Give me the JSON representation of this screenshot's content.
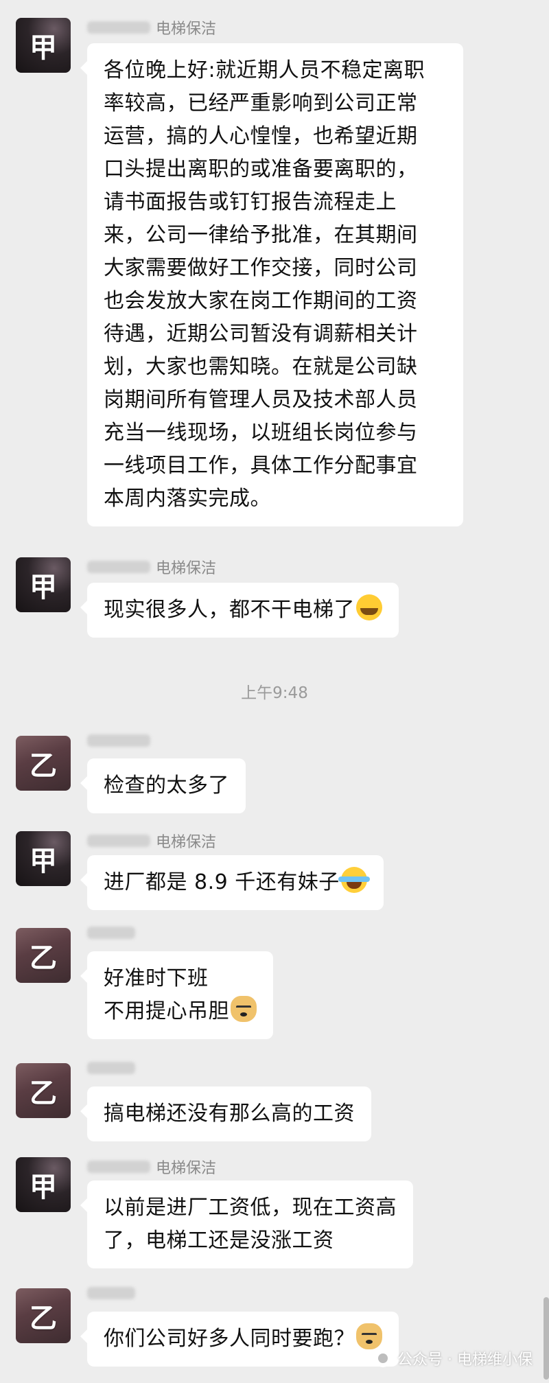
{
  "messages": [
    {
      "avatar": "甲",
      "sender": "电梯保洁",
      "lines": [
        "各位晚上好:就近期人员不稳定离职",
        "率较高，已经严重影响到公司正常",
        "运营，搞的人心惶惶，也希望近期",
        "口头提出离职的或准备要离职的，",
        "请书面报告或钉钉报告流程走上",
        "来，公司一律给予批准，在其期间",
        "大家需要做好工作交接，同时公司",
        "也会发放大家在岗工作期间的工资",
        "待遇，近期公司暂没有调薪相关计",
        "划，大家也需知晓。在就是公司缺",
        "岗期间所有管理人员及技术部人员",
        "充当一线现场，以班组长岗位参与",
        "一线项目工作，具体工作分配事宜",
        "本周内落实完成。"
      ]
    },
    {
      "avatar": "甲",
      "sender": "电梯保洁",
      "lines": [
        "现实很多人，都不干电梯了"
      ],
      "emoji": "cry-emoji"
    },
    {
      "avatar": "乙",
      "sender": "",
      "lines": [
        "检查的太多了"
      ]
    },
    {
      "avatar": "甲",
      "sender": "电梯保洁",
      "lines": [
        "进厂都是 8.9 千还有妹子"
      ],
      "emoji": "laugh-emoji"
    },
    {
      "avatar": "乙",
      "sender": "",
      "lines": [
        "好准时下班",
        "不用提心吊胆"
      ],
      "emoji": "doge-emoji"
    },
    {
      "avatar": "乙",
      "sender": "",
      "lines": [
        "搞电梯还没有那么高的工资"
      ]
    },
    {
      "avatar": "甲",
      "sender": "电梯保洁",
      "lines": [
        "以前是进厂工资低，现在工资高",
        "了，电梯工还是没涨工资"
      ]
    },
    {
      "avatar": "乙",
      "sender": "",
      "lines": [
        "你们公司好多人同时要跑？"
      ],
      "emoji": "doge-emoji"
    }
  ],
  "timestamp": "上午9:48",
  "watermark": "公众号 · 电梯维小保"
}
